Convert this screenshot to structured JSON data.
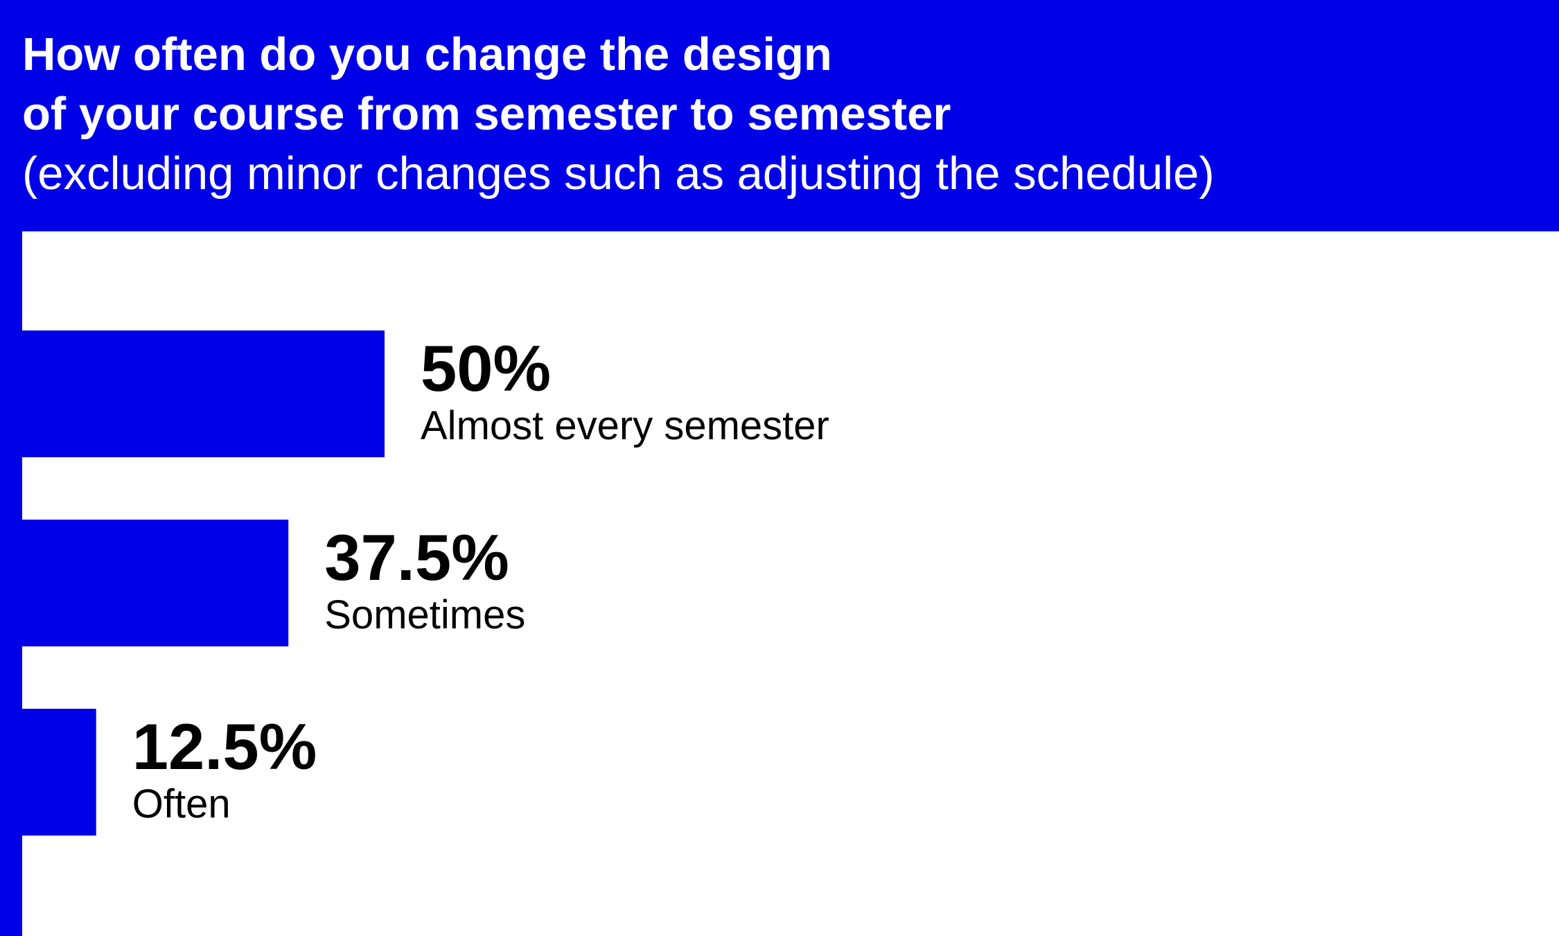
{
  "header": {
    "title_line1": "How often do you change the design",
    "title_line2": "of your course from semester to semester",
    "subtitle": "(excluding minor changes such as adjusting the schedule)"
  },
  "colors": {
    "accent": "#0000e6",
    "background": "#ffffff",
    "text": "#000000"
  },
  "chart_data": {
    "type": "bar",
    "orientation": "horizontal",
    "title": "How often do you change the design of your course from semester to semester",
    "subtitle": "(excluding minor changes such as adjusting the schedule)",
    "categories": [
      "Almost every semester",
      "Sometimes",
      "Often"
    ],
    "values": [
      50,
      37.5,
      12.5
    ],
    "value_labels": [
      "50%",
      "37.5%",
      "12.5%"
    ],
    "unit": "%",
    "grid": false,
    "legend": "none"
  }
}
